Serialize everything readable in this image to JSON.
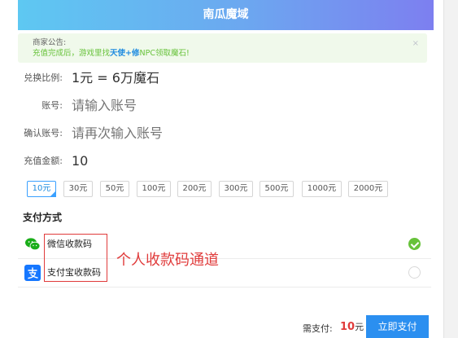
{
  "header": {
    "title": "南瓜魔域"
  },
  "notice": {
    "title": "商家公告:",
    "text_before": "充值完成后，游戏里找",
    "highlight": "天使+修",
    "text_after": "NPC领取魔石!",
    "close_icon": "×"
  },
  "form": {
    "rate_label": "兑换比例:",
    "rate_value": "1元 = 6万魔石",
    "account_label": "账号:",
    "account_placeholder": "请输入账号",
    "confirm_label": "确认账号:",
    "confirm_placeholder": "请再次输入账号",
    "amount_label": "充值金额:",
    "amount_value": "10"
  },
  "amount_options": [
    {
      "label": "10元",
      "selected": true
    },
    {
      "label": "30元",
      "selected": false
    },
    {
      "label": "50元",
      "selected": false
    },
    {
      "label": "100元",
      "selected": false
    },
    {
      "label": "200元",
      "selected": false
    },
    {
      "label": "300元",
      "selected": false
    },
    {
      "label": "500元",
      "selected": false
    },
    {
      "label": "1000元",
      "selected": false
    },
    {
      "label": "2000元",
      "selected": false
    }
  ],
  "payment": {
    "title": "支付方式",
    "methods": [
      {
        "label": "微信收款码",
        "icon": "wechat-icon",
        "color": "#1aad19",
        "selected": true
      },
      {
        "label": "支付宝收款码",
        "icon": "alipay-icon",
        "color": "#1677ff",
        "selected": false
      }
    ],
    "annotation": "个人收款码通道"
  },
  "footer": {
    "due_label": "需支付:",
    "due_amount": "10",
    "due_unit": "元",
    "pay_button": "立即支付"
  }
}
